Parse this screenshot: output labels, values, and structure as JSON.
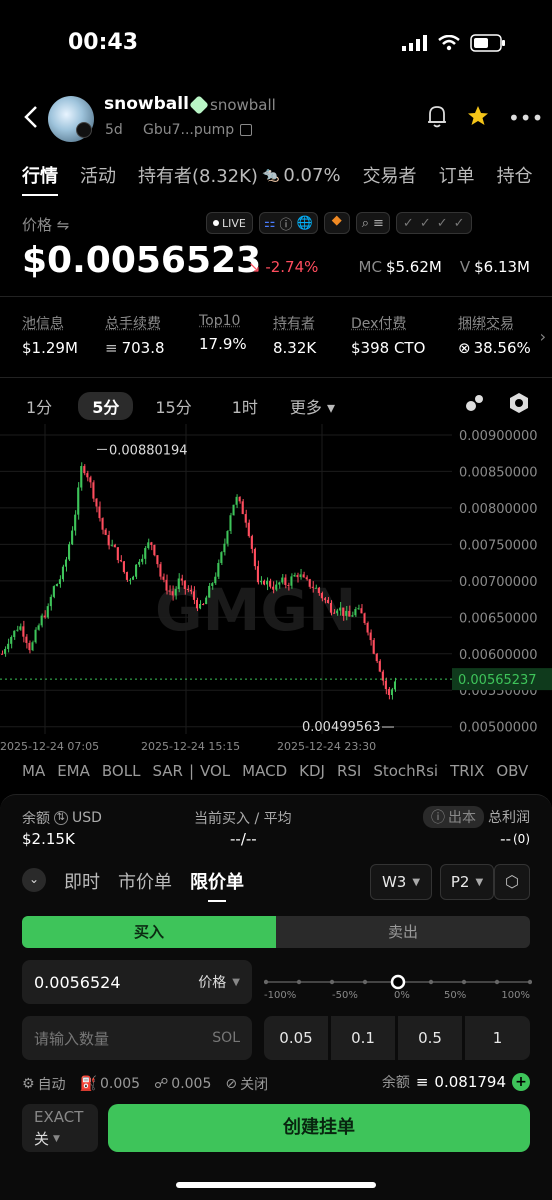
{
  "status": {
    "time": "00:43"
  },
  "header": {
    "token_name": "snowball",
    "token_sub": "snowball",
    "age": "5d",
    "address": "Gbu7...pump"
  },
  "tabs": [
    "行情",
    "活动",
    "持有者(8.32K)",
    "0.07%",
    "交易者",
    "订单",
    "持仓"
  ],
  "price": {
    "label": "价格 ⇋",
    "value": "$0.0056523",
    "change": "↘ -2.74%",
    "mc_label": "MC",
    "mc_value": "$5.62M",
    "v_label": "V",
    "v_value": "$6.13M",
    "live": "LIVE"
  },
  "info": [
    {
      "label": "池信息",
      "value": "$1.29M"
    },
    {
      "label": "总手续费",
      "value": "703.8"
    },
    {
      "label": "Top10",
      "value": "17.9%"
    },
    {
      "label": "持有者",
      "value": "8.32K"
    },
    {
      "label": "Dex付费",
      "value": "$398 CTO"
    },
    {
      "label": "捆绑交易",
      "value": "38.56%"
    }
  ],
  "timeframes": [
    "1分",
    "5分",
    "15分",
    "1时",
    "更多 ▾"
  ],
  "chart_data": {
    "type": "candlestick",
    "y_ticks": [
      "0.00900000",
      "0.00850000",
      "0.00800000",
      "0.00750000",
      "0.00700000",
      "0.00650000",
      "0.00600000",
      "0.00550000",
      "0.00500000"
    ],
    "ylim": [
      0.0049,
      0.00915
    ],
    "x_ticks": [
      "2025-12-24 07:05",
      "2025-12-24 15:15",
      "2025-12-24 23:30"
    ],
    "high_label": "0.00880194",
    "low_label": "0.00499563",
    "current_label": "0.00565237",
    "watermark": "GMGN",
    "close_path": [
      0.006,
      0.00618,
      0.00628,
      0.0064,
      0.00625,
      0.00605,
      0.0063,
      0.0065,
      0.0066,
      0.0069,
      0.007,
      0.0072,
      0.0076,
      0.008,
      0.0086,
      0.00845,
      0.0082,
      0.0079,
      0.0076,
      0.0075,
      0.0074,
      0.0072,
      0.007,
      0.0071,
      0.0073,
      0.0074,
      0.00755,
      0.00735,
      0.007,
      0.0069,
      0.0068,
      0.007,
      0.0069,
      0.00685,
      0.0067,
      0.0066,
      0.0068,
      0.007,
      0.0072,
      0.0075,
      0.0079,
      0.00815,
      0.008,
      0.0078,
      0.0074,
      0.0069,
      0.007,
      0.00695,
      0.0069,
      0.007,
      0.00695,
      0.00705,
      0.0071,
      0.007,
      0.00695,
      0.0069,
      0.0068,
      0.0067,
      0.0066,
      0.00665,
      0.00655,
      0.0065,
      0.0066,
      0.00655,
      0.0064,
      0.0061,
      0.0059,
      0.0056,
      0.0054,
      0.00565
    ]
  },
  "indicators": [
    "MA",
    "EMA",
    "BOLL",
    "SAR",
    "|",
    "VOL",
    "MACD",
    "KDJ",
    "RSI",
    "StochRsi",
    "TRIX",
    "OBV"
  ],
  "trade": {
    "balance_label": "余额",
    "balance_unit": "USD",
    "balance_value": "$2.15K",
    "avg_label": "当前买入 / 平均",
    "avg_value": "--/--",
    "cost_label": "出本",
    "profit_label": "总利润",
    "profit_value": "--",
    "profit_count": "(0)",
    "order_types": [
      "即时",
      "市价单",
      "限价单"
    ],
    "w_select": "W3",
    "p_select": "P2",
    "buy": "买入",
    "sell": "卖出",
    "price_value": "0.0056524",
    "price_select": "价格",
    "slider_labels": [
      "-100%",
      "-50%",
      "0%",
      "50%",
      "100%"
    ],
    "slider_value_pct": 0,
    "qty_placeholder": "请输入数量",
    "qty_unit": "SOL",
    "quick_amounts": [
      "0.05",
      "0.1",
      "0.5",
      "1"
    ],
    "auto": "自动",
    "fee1": "0.005",
    "fee2": "0.005",
    "close": "关闭",
    "sol_balance_label": "余额",
    "sol_balance": "0.081794",
    "exact": "EXACT",
    "exact_sub": "关",
    "create": "创建挂单"
  }
}
